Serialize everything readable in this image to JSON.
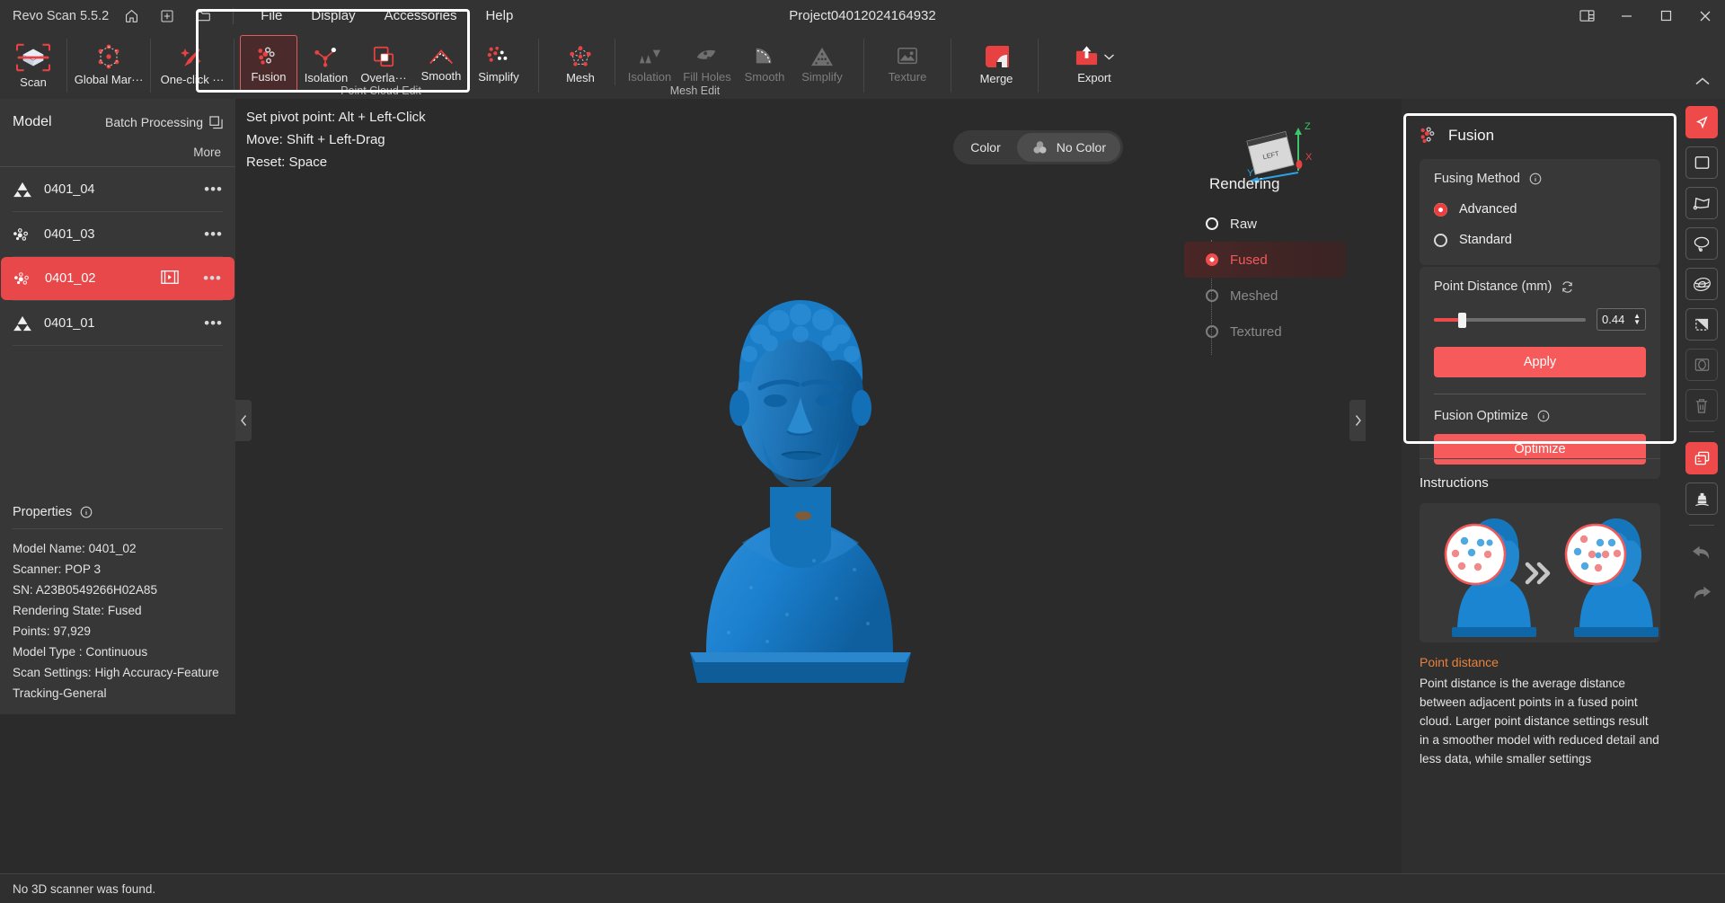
{
  "titlebar": {
    "app_name": "Revo Scan 5.5.2",
    "project_title": "Project04012024164932",
    "icons": [
      "home-icon",
      "new-project-icon",
      "open-folder-icon"
    ],
    "menus": [
      "File",
      "Display",
      "Accessories",
      "Help"
    ],
    "window_controls": [
      "layout-icon",
      "minimize-icon",
      "maximize-icon",
      "close-icon"
    ]
  },
  "ribbon": {
    "scan": {
      "label": "Scan",
      "icon": "scan-cube-icon"
    },
    "left_tools": [
      {
        "label": "Global Mar···",
        "icon": "global-marker-icon"
      },
      {
        "label": "One-click ···",
        "icon": "one-click-wand-icon"
      }
    ],
    "point_cloud_edit": {
      "group_label": "Point Cloud Edit",
      "items": [
        {
          "label": "Fusion",
          "icon": "fusion-points-icon",
          "active": true
        },
        {
          "label": "Isolation",
          "icon": "isolation-icon",
          "active": false
        },
        {
          "label": "Overla···",
          "icon": "overlap-squares-icon",
          "active": false
        },
        {
          "label": "Smooth",
          "icon": "smooth-curve-icon",
          "active": false
        },
        {
          "label": "Simplify",
          "icon": "simplify-points-icon",
          "active": false
        }
      ]
    },
    "mesh_edit": {
      "group_label": "Mesh Edit",
      "mesh_button": {
        "label": "Mesh",
        "icon": "mesh-network-icon"
      },
      "items": [
        {
          "label": "Isolation",
          "icon": "mesh-isolation-icon",
          "disabled": true
        },
        {
          "label": "Fill Holes",
          "icon": "fill-holes-icon",
          "disabled": true
        },
        {
          "label": "Smooth",
          "icon": "mesh-smooth-icon",
          "disabled": true
        },
        {
          "label": "Simplify",
          "icon": "mesh-simplify-icon",
          "disabled": true
        }
      ]
    },
    "texture": {
      "label": "Texture",
      "icon": "texture-image-icon",
      "disabled": true
    },
    "merge": {
      "label": "Merge",
      "icon": "merge-squares-icon"
    },
    "export": {
      "label": "Export",
      "icon": "export-upload-icon",
      "has_dropdown": true
    },
    "collapse_icon": "chevron-up-icon"
  },
  "left_panel": {
    "title": "Model",
    "batch_processing": "Batch Processing",
    "batch_icon": "batch-copy-icon",
    "more": "More",
    "models": [
      {
        "name": "0401_04",
        "icon": "mesh-triangles-icon",
        "selected": false,
        "has_frames_icon": false
      },
      {
        "name": "0401_03",
        "icon": "point-cloud-icon",
        "selected": false,
        "has_frames_icon": false
      },
      {
        "name": "0401_02",
        "icon": "point-cloud-icon",
        "selected": true,
        "has_frames_icon": true
      },
      {
        "name": "0401_01",
        "icon": "mesh-triangles-icon",
        "selected": false,
        "has_frames_icon": false
      }
    ],
    "menu_icon": "ellipsis-icon",
    "frames_icon": "film-frames-icon",
    "properties": {
      "title": "Properties",
      "info_icon": "info-circle-icon",
      "rows": [
        {
          "label": "Model Name:",
          "value": "0401_02"
        },
        {
          "label": "Scanner:",
          "value": "POP 3"
        },
        {
          "label": "SN:",
          "value": "A23B0549266H02A85"
        },
        {
          "label": "Rendering State:",
          "value": "Fused"
        },
        {
          "label": "Points:",
          "value": "97,929"
        },
        {
          "label": "Model Type :",
          "value": "Continuous"
        },
        {
          "label": "Scan Settings:",
          "value": "High Accuracy-Feature Tracking-General"
        }
      ]
    }
  },
  "statusbar": {
    "message": "No 3D scanner was found."
  },
  "viewport": {
    "hints": [
      "Set pivot point: Alt + Left-Click",
      "Move: Shift + Left-Drag",
      "Reset: Space"
    ],
    "color_toggle": {
      "options": [
        "Color",
        "No Color"
      ],
      "selected": "No Color",
      "icon": "color-wheel-icon"
    },
    "axis_gizmo": {
      "face_label": "LEFT",
      "axes": [
        "X",
        "Y",
        "Z"
      ],
      "x_color": "#e84141",
      "y_color": "#2aa3e8",
      "z_color": "#3ec46a"
    },
    "rendering": {
      "title": "Rendering",
      "options": [
        {
          "label": "Raw",
          "state": "available",
          "selected": false
        },
        {
          "label": "Fused",
          "state": "available",
          "selected": true
        },
        {
          "label": "Meshed",
          "state": "disabled",
          "selected": false
        },
        {
          "label": "Textured",
          "state": "disabled",
          "selected": false
        }
      ]
    },
    "collapse_left_icon": "chevron-left-icon",
    "collapse_right_icon": "chevron-right-icon",
    "model_color": "#1c87d6"
  },
  "fusion_panel": {
    "title": "Fusion",
    "title_icon": "fusion-points-icon",
    "fusing_method": {
      "label": "Fusing Method",
      "info_icon": "info-circle-icon",
      "options": [
        {
          "label": "Advanced",
          "selected": true
        },
        {
          "label": "Standard",
          "selected": false
        }
      ]
    },
    "point_distance": {
      "label": "Point Distance (mm)",
      "reset_icon": "refresh-icon",
      "value": "0.44",
      "slider_percent": 17
    },
    "apply_button": "Apply",
    "fusion_optimize": {
      "label": "Fusion Optimize",
      "info_icon": "info-circle-icon",
      "button": "Optimize"
    },
    "accent_color": "#f65a5a"
  },
  "instructions": {
    "title": "Instructions",
    "image_name": "point-distance-illustration",
    "arrow_icon": "double-chevron-right-icon",
    "heading": "Point distance",
    "body": "Point distance is the average distance between adjacent points in a fused point cloud. Larger point distance settings result in a smoother model with reduced detail and less data, while smaller settings"
  },
  "right_toolbar": {
    "buttons": [
      {
        "icon": "cursor-select-icon",
        "state": "active"
      },
      {
        "icon": "rectangle-select-icon",
        "state": "normal"
      },
      {
        "icon": "polygon-select-icon",
        "state": "normal"
      },
      {
        "icon": "lasso-select-icon",
        "state": "normal"
      },
      {
        "icon": "sphere-select-icon",
        "state": "normal"
      },
      {
        "icon": "plane-cut-icon",
        "state": "normal"
      },
      {
        "icon": "invert-selection-icon",
        "state": "disabled"
      },
      {
        "icon": "delete-icon",
        "state": "disabled"
      },
      {
        "icon": "duplicate-layers-icon",
        "state": "active"
      },
      {
        "icon": "stamp-tool-icon",
        "state": "normal"
      },
      {
        "icon": "undo-icon",
        "state": "disabled"
      },
      {
        "icon": "redo-icon",
        "state": "disabled"
      }
    ]
  }
}
